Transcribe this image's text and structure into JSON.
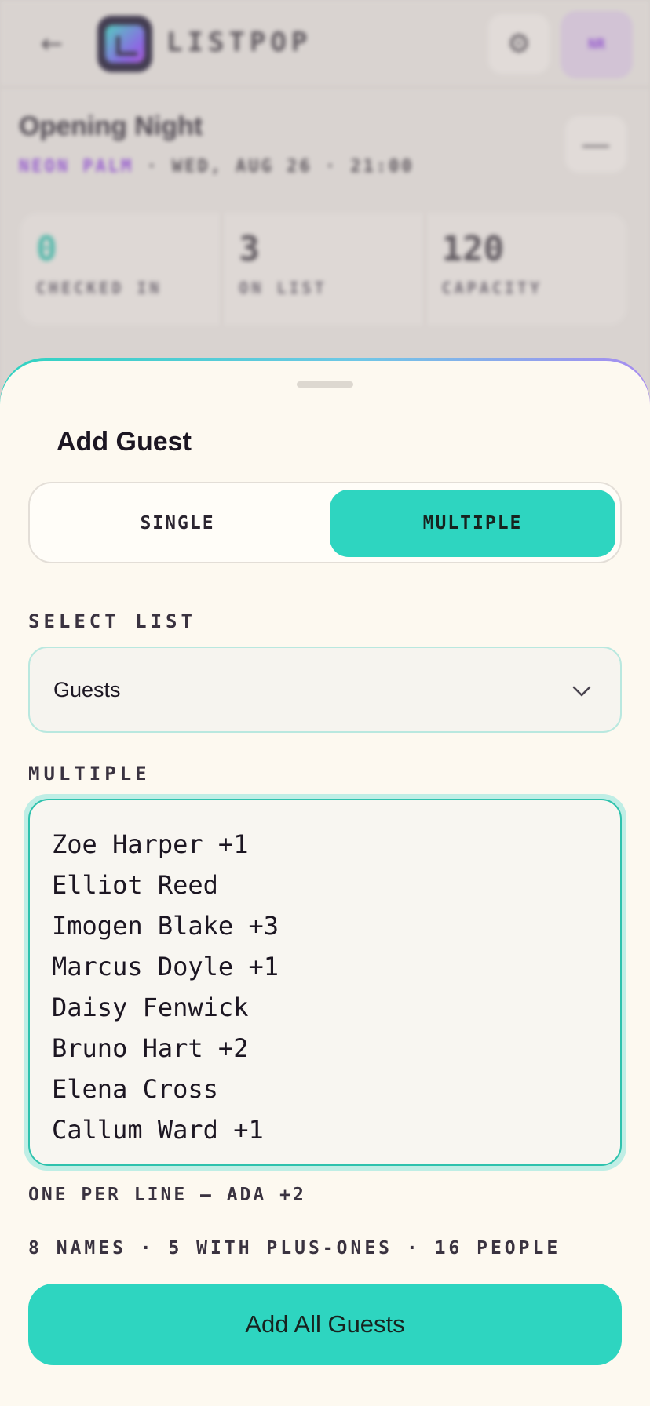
{
  "app": {
    "brand": "LISTPOP",
    "back_icon": "arrow-left-icon",
    "settings_icon": "gear-icon",
    "avatar_initials": "NR"
  },
  "event": {
    "title": "Opening Night",
    "venue": "NEON PALM",
    "datetime": "· WED, AUG 26 · 21:00",
    "more_icon": "more-icon"
  },
  "stats": [
    {
      "value": "0",
      "label": "CHECKED IN"
    },
    {
      "value": "3",
      "label": "ON LIST"
    },
    {
      "value": "120",
      "label": "CAPACITY"
    }
  ],
  "sheet": {
    "title": "Add Guest",
    "modes": {
      "single": "SINGLE",
      "multiple": "MULTIPLE",
      "active": "multiple"
    },
    "select_label": "SELECT LIST",
    "select_value": "Guests",
    "multiple_label": "MULTIPLE",
    "names": [
      "Zoe Harper +1",
      "Elliot Reed",
      "Imogen Blake +3",
      "Marcus Doyle +1",
      "Daisy Fenwick",
      "Bruno Hart +2",
      "Elena Cross",
      "Callum Ward +1"
    ],
    "hint": "ONE PER LINE — ADA +2",
    "summary": "8 NAMES · 5 WITH PLUS-ONES · 16 PEOPLE",
    "submit_label": "Add All Guests"
  },
  "colors": {
    "accent": "#2ed5c0",
    "brand_purple": "#8a3fd6",
    "sheet_bg": "#fdf9f0"
  }
}
